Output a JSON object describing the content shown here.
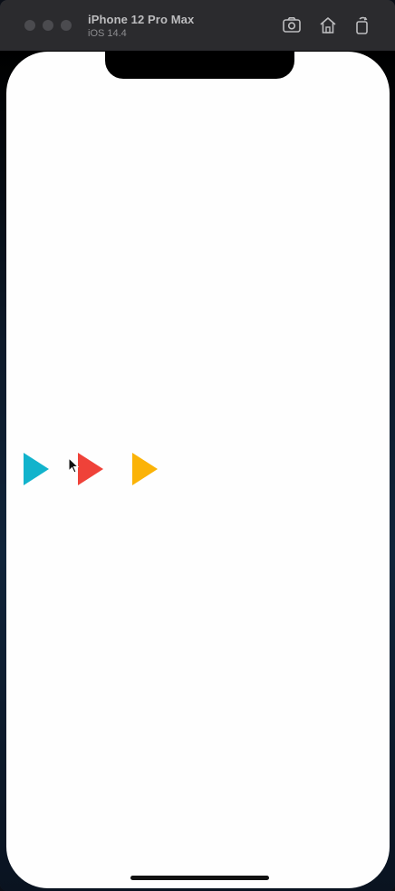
{
  "titlebar": {
    "device_name": "iPhone 12 Pro Max",
    "os_version": "iOS 14.4",
    "icons": [
      "screenshot-icon",
      "home-icon",
      "rotate-icon"
    ]
  },
  "screen": {
    "background": "#fefefe",
    "play_buttons": [
      {
        "name": "play-icon-cyan",
        "color": "#12b3cc"
      },
      {
        "name": "play-icon-red",
        "color": "#ef4239"
      },
      {
        "name": "play-icon-amber",
        "color": "#fbb307"
      }
    ]
  }
}
